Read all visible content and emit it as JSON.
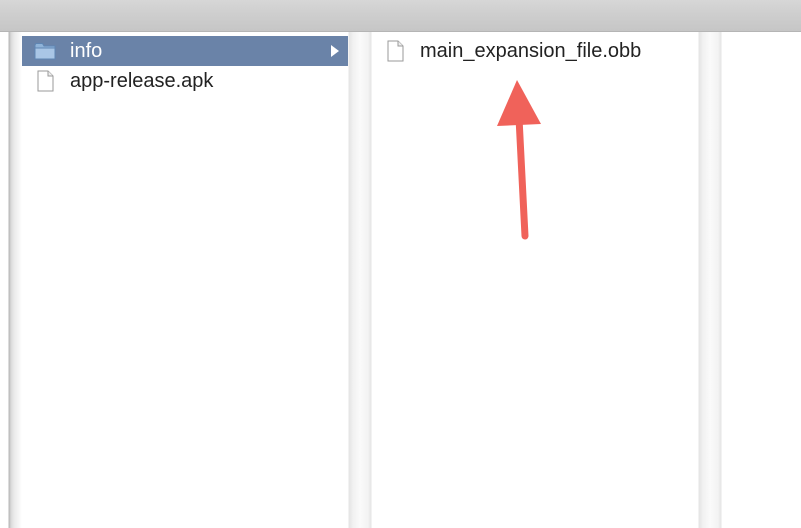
{
  "column_1": {
    "items": [
      {
        "label": "info",
        "icon": "folder-icon",
        "selected": true
      },
      {
        "label": "app-release.apk",
        "icon": "document-icon",
        "selected": false
      }
    ]
  },
  "column_2": {
    "items": [
      {
        "label": "main_expansion_file.obb",
        "icon": "document-icon",
        "selected": false
      }
    ]
  },
  "colors": {
    "selection": "#6a83a8",
    "arrow": "#f0625a",
    "folder": "#8fb3d8"
  },
  "annotation": {
    "type": "arrow",
    "points_to": "main_expansion_file.obb"
  }
}
